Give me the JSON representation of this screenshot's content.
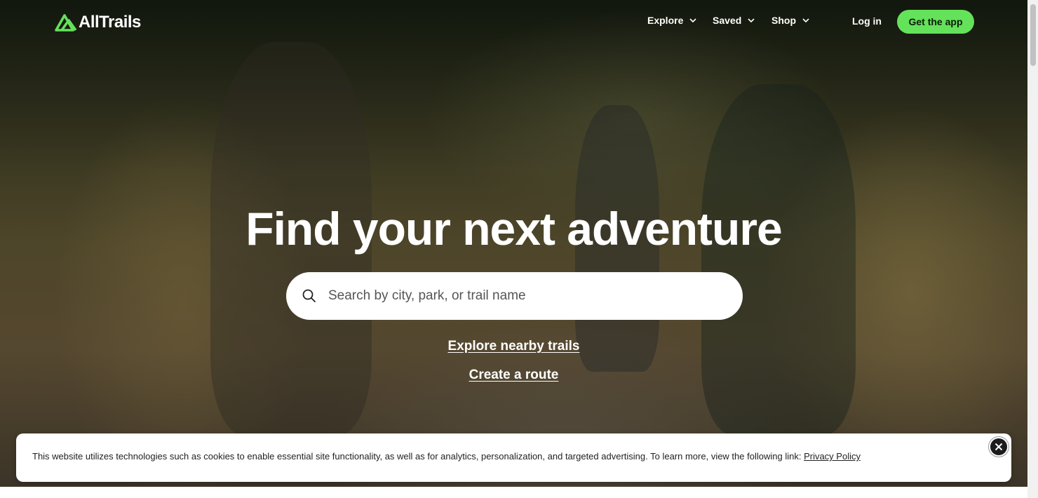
{
  "brand": {
    "name": "AllTrails",
    "accent": "#64e25a"
  },
  "nav": {
    "items": [
      {
        "label": "Explore",
        "icon": "chevron-down-icon"
      },
      {
        "label": "Saved",
        "icon": "chevron-down-icon"
      },
      {
        "label": "Shop",
        "icon": "chevron-down-icon"
      }
    ],
    "login_label": "Log in",
    "get_app_label": "Get the app"
  },
  "hero": {
    "headline": "Find your next adventure",
    "search": {
      "placeholder": "Search by city, park, or trail name",
      "icon": "search-icon"
    },
    "links": {
      "explore_nearby": "Explore nearby trails",
      "create_route": "Create a route"
    }
  },
  "cookie_banner": {
    "text": "This website utilizes technologies such as cookies to enable essential site functionality, as well as for analytics, personalization, and targeted advertising. To learn more, view the following link:",
    "link_label": "Privacy Policy",
    "close_icon": "close-icon"
  }
}
